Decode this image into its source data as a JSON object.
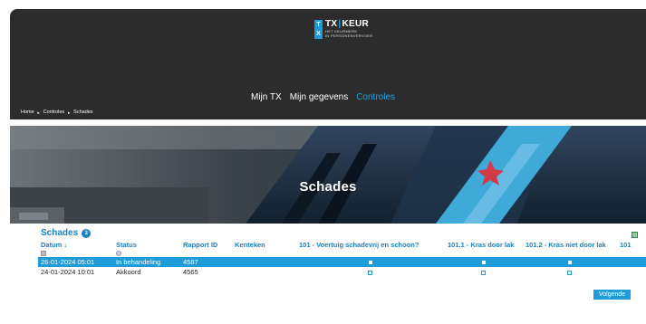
{
  "header": {
    "logo_text_left": "TX",
    "logo_text_right": "KEUR",
    "logo_sub_line1": "HET KEURMERK",
    "logo_sub_line2": "IN PERSONENVERVOER",
    "logo_badge_top": "T",
    "logo_badge_bottom": "X"
  },
  "nav": {
    "items": [
      {
        "label": "Mijn TX",
        "active": false
      },
      {
        "label": "Mijn gegevens",
        "active": false
      },
      {
        "label": "Controles",
        "active": true
      }
    ]
  },
  "breadcrumb": {
    "items": [
      "Home",
      "Controles",
      "Schades"
    ],
    "separator": "►"
  },
  "hero": {
    "title": "Schades"
  },
  "section": {
    "title": "Schades",
    "count": "3"
  },
  "table": {
    "columns": [
      "Datum",
      "Status",
      "Rapport ID",
      "Kenteken",
      "101 - Voertuig schadevrij en schoon?",
      "101.1 - Kras door lak",
      "101.2 - Kras niet door lak",
      "101"
    ],
    "sort_indicator": "↓",
    "rows": [
      {
        "datum": "26-01-2024 05:01",
        "status": "In behandeling",
        "rapport_id": "4587",
        "kenteken": "",
        "c101": "checked",
        "c1011": "checked",
        "c1012": "checked",
        "selected": true
      },
      {
        "datum": "24-01-2024 10:01",
        "status": "Akkoord",
        "rapport_id": "4565",
        "kenteken": "",
        "c101": "unchecked",
        "c1011": "unchecked",
        "c1012": "unchecked",
        "selected": false
      }
    ]
  },
  "pagination": {
    "next_label": "Volgende"
  },
  "colors": {
    "accent": "#1f9bd7",
    "header_bg": "#2c2c2c",
    "title_blue": "#1a80c4"
  }
}
